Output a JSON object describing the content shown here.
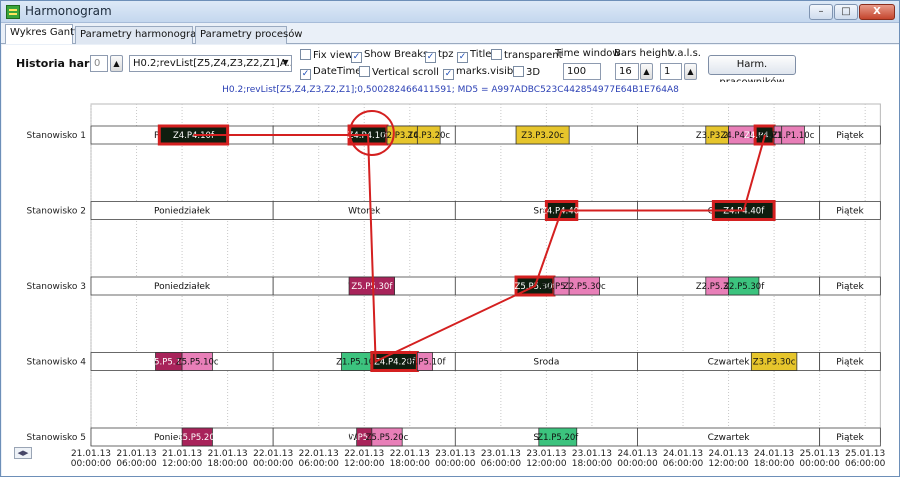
{
  "window": {
    "title": "Harmonogram",
    "buttons": {
      "minimize": "–",
      "maximize": "□",
      "close": "X"
    }
  },
  "tabs": [
    "Wykres Gantta",
    "Parametry harmonogramu",
    "Parametry procesów"
  ],
  "toolbar": {
    "hist_label": "Historia harm.",
    "hist_value": "0",
    "hist_select": "H0.2;revList[Z5,Z4,Z3,Z2,Z1]A...",
    "checkboxes": [
      {
        "label": "Fix view",
        "checked": false
      },
      {
        "label": "Show Breaks",
        "checked": true
      },
      {
        "label": "tpz",
        "checked": true
      },
      {
        "label": "Title",
        "checked": true
      },
      {
        "label": "transparent",
        "checked": false
      },
      {
        "label": "DateTime",
        "checked": true
      },
      {
        "label": "Vertical scroll",
        "checked": false
      },
      {
        "label": "marks.visible",
        "checked": true
      },
      {
        "label": "3D",
        "checked": false
      }
    ],
    "time_window_label": "Time window",
    "time_window_value": "100",
    "bars_height_label": "Bars height",
    "bars_height_value": "16",
    "vals_label": "v.a.l.s.",
    "vals_value": "1",
    "harm_button": "Harm. pracowników"
  },
  "chart_header": "H0.2;revList[Z5,Z4,Z3,Z2,Z1];0,500282466411591; MD5 = A997ADBC523C442854977E64B1E764A8",
  "colors": {
    "highlight": "#d42020",
    "dark": "#0f1e0f",
    "yellow": "#e6c52c",
    "pink": "#e87fb8",
    "maroon": "#a8235a",
    "green": "#3cc37e",
    "grid": "#c8c8c8"
  },
  "chart_data": {
    "type": "gantt",
    "rows": [
      "Stanowisko 1",
      "Stanowisko 2",
      "Stanowisko 3",
      "Stanowisko 4",
      "Stanowisko 5"
    ],
    "x_ticks": [
      {
        "t": 0,
        "date": "21.01.13",
        "time": "00:00:00"
      },
      {
        "t": 6,
        "date": "21.01.13",
        "time": "06:00:00"
      },
      {
        "t": 12,
        "date": "21.01.13",
        "time": "12:00:00"
      },
      {
        "t": 18,
        "date": "21.01.13",
        "time": "18:00:00"
      },
      {
        "t": 24,
        "date": "22.01.13",
        "time": "00:00:00"
      },
      {
        "t": 30,
        "date": "22.01.13",
        "time": "06:00:00"
      },
      {
        "t": 36,
        "date": "22.01.13",
        "time": "12:00:00"
      },
      {
        "t": 42,
        "date": "22.01.13",
        "time": "18:00:00"
      },
      {
        "t": 48,
        "date": "23.01.13",
        "time": "00:00:00"
      },
      {
        "t": 54,
        "date": "23.01.13",
        "time": "06:00:00"
      },
      {
        "t": 60,
        "date": "23.01.13",
        "time": "12:00:00"
      },
      {
        "t": 66,
        "date": "23.01.13",
        "time": "18:00:00"
      },
      {
        "t": 72,
        "date": "24.01.13",
        "time": "00:00:00"
      },
      {
        "t": 78,
        "date": "24.01.13",
        "time": "06:00:00"
      },
      {
        "t": 84,
        "date": "24.01.13",
        "time": "12:00:00"
      },
      {
        "t": 90,
        "date": "24.01.13",
        "time": "18:00:00"
      },
      {
        "t": 96,
        "date": "25.01.13",
        "time": "00:00:00"
      },
      {
        "t": 102,
        "date": "25.01.13",
        "time": "06:00:00"
      }
    ],
    "xlim": [
      0,
      104
    ],
    "day_labels": [
      {
        "start": 0,
        "end": 24,
        "label": "Poniedziałek"
      },
      {
        "start": 24,
        "end": 48,
        "label": "Wtorek"
      },
      {
        "start": 48,
        "end": 72,
        "label": "Sroda"
      },
      {
        "start": 72,
        "end": 96,
        "label": "Czwartek"
      },
      {
        "start": 96,
        "end": 120,
        "label": "Piątek"
      }
    ],
    "tasks": [
      {
        "row": 0,
        "start": 9,
        "end": 18,
        "label": "Z4.P4.10f",
        "color": "dark",
        "hl": true
      },
      {
        "row": 0,
        "start": 34,
        "end": 39,
        "label": "Z4.P4.10f",
        "color": "dark",
        "hl": true
      },
      {
        "row": 0,
        "start": 39,
        "end": 43,
        "label": "Z2.P3.10c",
        "color": "yellow",
        "hl": false
      },
      {
        "row": 0,
        "start": 43,
        "end": 46,
        "label": "Z4.P3.20c",
        "color": "yellow",
        "hl": false
      },
      {
        "row": 0,
        "start": 56,
        "end": 63,
        "label": "Z3.P3.20c",
        "color": "yellow",
        "hl": false
      },
      {
        "row": 0,
        "start": 81,
        "end": 84,
        "label": "Z3.P3.20c",
        "color": "yellow",
        "hl": false
      },
      {
        "row": 0,
        "start": 84,
        "end": 87.5,
        "label": "Z4.P4.10c",
        "color": "pink",
        "hl": false
      },
      {
        "row": 0,
        "start": 87.5,
        "end": 90,
        "label": "Z4.P4.10f",
        "color": "dark",
        "hl": true
      },
      {
        "row": 0,
        "start": 90,
        "end": 91,
        "label": "Z1.P1.10f",
        "color": "pink",
        "hl": false
      },
      {
        "row": 0,
        "start": 91,
        "end": 94,
        "label": "Z1.P1.10c",
        "color": "pink",
        "hl": false
      },
      {
        "row": 1,
        "start": 60,
        "end": 64,
        "label": "Z4.P4.40f",
        "color": "dark",
        "hl": true
      },
      {
        "row": 1,
        "start": 82,
        "end": 90,
        "label": "Z4.P4.40f",
        "color": "dark",
        "hl": true
      },
      {
        "row": 2,
        "start": 34,
        "end": 40,
        "label": "Z5.P5.30f",
        "color": "maroon",
        "hl": false
      },
      {
        "row": 2,
        "start": 56,
        "end": 61,
        "label": "Z5.P5.30f",
        "color": "dark",
        "hl": true
      },
      {
        "row": 2,
        "start": 61,
        "end": 63,
        "label": "Z2.P5.30f",
        "color": "pink",
        "hl": false
      },
      {
        "row": 2,
        "start": 63,
        "end": 67,
        "label": "Z2.P5.30c",
        "color": "pink",
        "hl": false
      },
      {
        "row": 2,
        "start": 81,
        "end": 84,
        "label": "Z2.P5.30c",
        "color": "pink",
        "hl": false
      },
      {
        "row": 2,
        "start": 84,
        "end": 88,
        "label": "Z2.P5.30f",
        "color": "green",
        "hl": false
      },
      {
        "row": 3,
        "start": 8.5,
        "end": 12,
        "label": "Z5.P5.10f",
        "color": "maroon",
        "hl": false
      },
      {
        "row": 3,
        "start": 12,
        "end": 16,
        "label": "Z5.P5.10c",
        "color": "pink",
        "hl": false
      },
      {
        "row": 3,
        "start": 33,
        "end": 37,
        "label": "Z1.P5.10f",
        "color": "green",
        "hl": false
      },
      {
        "row": 3,
        "start": 37,
        "end": 43,
        "label": "Z4.P4.20f",
        "color": "dark",
        "hl": true
      },
      {
        "row": 3,
        "start": 43,
        "end": 45,
        "label": "Z5.P5.10f",
        "color": "pink",
        "hl": false
      },
      {
        "row": 3,
        "start": 87,
        "end": 93,
        "label": "Z3.P3.30c",
        "color": "yellow",
        "hl": false
      },
      {
        "row": 4,
        "start": 12,
        "end": 16,
        "label": "Z5.P5.20f",
        "color": "maroon",
        "hl": false
      },
      {
        "row": 4,
        "start": 35,
        "end": 37,
        "label": "Z5.P5.20f",
        "color": "maroon",
        "hl": false
      },
      {
        "row": 4,
        "start": 37,
        "end": 41,
        "label": "Z5.P5.20c",
        "color": "pink",
        "hl": false
      },
      {
        "row": 4,
        "start": 59,
        "end": 64,
        "label": "Z1.P5.20f",
        "color": "green",
        "hl": false
      }
    ],
    "path": [
      {
        "row": 0,
        "t": 13.5
      },
      {
        "row": 0,
        "t": 36.5
      },
      {
        "row": 3,
        "t": 37.5
      },
      {
        "row": 2,
        "t": 58.5
      },
      {
        "row": 1,
        "t": 62
      },
      {
        "row": 1,
        "t": 86
      },
      {
        "row": 0,
        "t": 88.8
      }
    ],
    "circle": {
      "row": 0,
      "t": 37
    }
  }
}
